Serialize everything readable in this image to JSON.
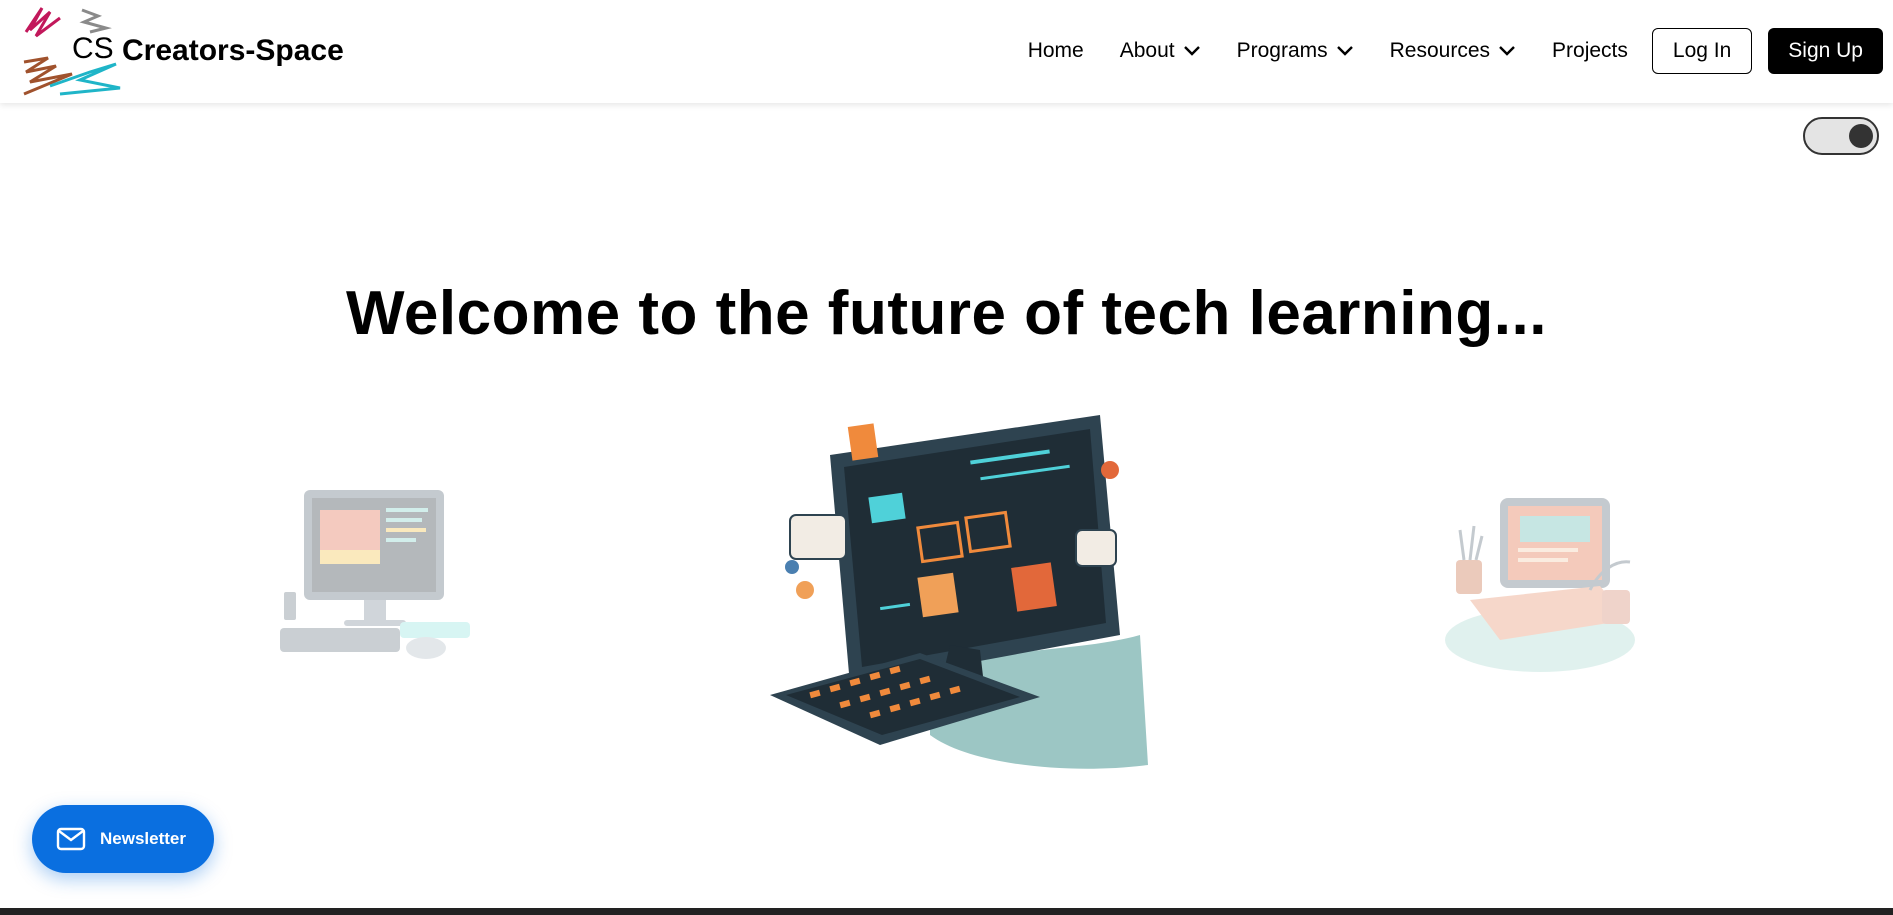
{
  "logo": {
    "text": "CS",
    "colors": [
      "#c2185b",
      "#8a8a8a",
      "#a0522d",
      "#1fb5c8"
    ]
  },
  "brand": {
    "name": "Creators-Space"
  },
  "nav": {
    "items": [
      {
        "label": "Home",
        "dropdown": false
      },
      {
        "label": "About",
        "dropdown": true
      },
      {
        "label": "Programs",
        "dropdown": true
      },
      {
        "label": "Resources",
        "dropdown": true
      },
      {
        "label": "Projects",
        "dropdown": false
      }
    ],
    "login_label": "Log In",
    "signup_label": "Sign Up"
  },
  "theme_toggle": {
    "state": "on"
  },
  "hero": {
    "title": "Welcome to the future of tech learning...",
    "carousel": [
      {
        "name": "desktop-computer-illustration",
        "active": false
      },
      {
        "name": "futuristic-monitor-keyboard-illustration",
        "active": true
      },
      {
        "name": "laptop-coding-illustration",
        "active": false
      }
    ]
  },
  "newsletter": {
    "label": "Newsletter",
    "icon": "mail-icon",
    "color": "#0a6fe0"
  }
}
